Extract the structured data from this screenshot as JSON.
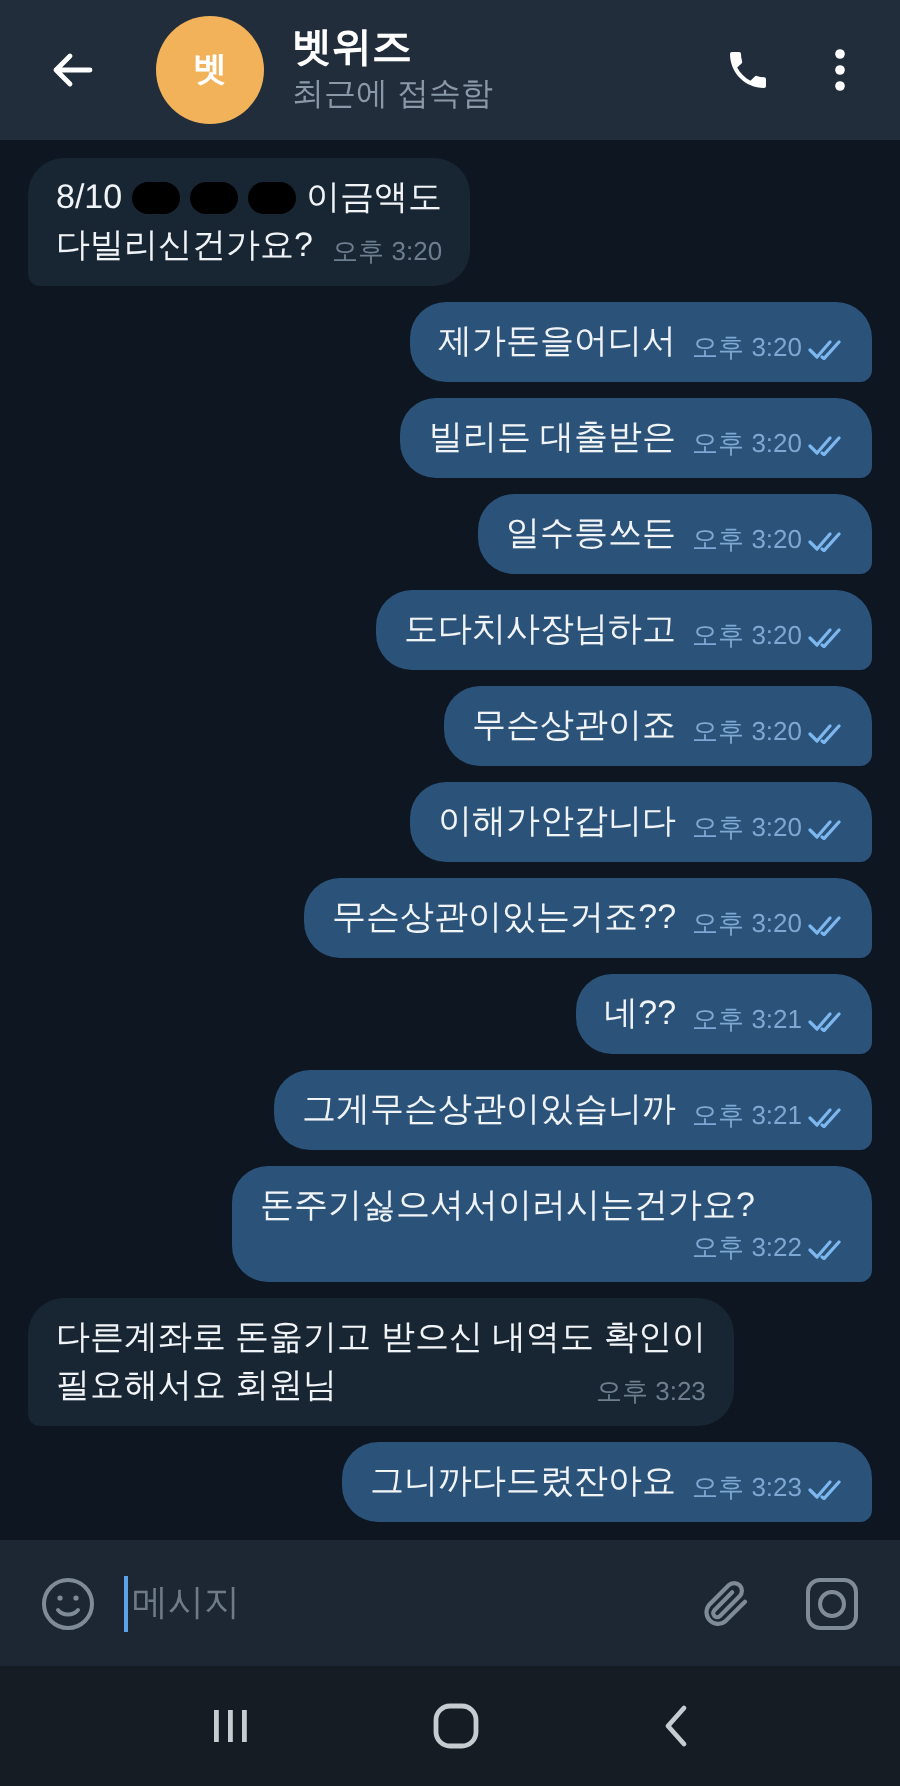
{
  "header": {
    "avatar_letter": "벳",
    "name": "벳위즈",
    "status": "최근에 접속함"
  },
  "messages": [
    {
      "kind": "incoming",
      "lines": [
        [
          {
            "kind": "text",
            "text": "8/10"
          },
          {
            "kind": "redacted"
          },
          {
            "kind": "redacted"
          },
          {
            "kind": "redacted"
          },
          {
            "kind": "text",
            "text": "이금액도"
          }
        ],
        [
          {
            "kind": "text",
            "text": "다빌리신건가요?"
          }
        ]
      ],
      "time": "오후 3:20"
    },
    {
      "kind": "outgoing",
      "lines": [
        [
          {
            "kind": "text",
            "text": "제가돈을어디서"
          }
        ]
      ],
      "time": "오후 3:20",
      "read": true
    },
    {
      "kind": "outgoing",
      "lines": [
        [
          {
            "kind": "text",
            "text": "빌리든 대출받은"
          }
        ]
      ],
      "time": "오후 3:20",
      "read": true
    },
    {
      "kind": "outgoing",
      "lines": [
        [
          {
            "kind": "text",
            "text": "일수릉쓰든"
          }
        ]
      ],
      "time": "오후 3:20",
      "read": true
    },
    {
      "kind": "outgoing",
      "lines": [
        [
          {
            "kind": "text",
            "text": "도다치사장님하고"
          }
        ]
      ],
      "time": "오후 3:20",
      "read": true
    },
    {
      "kind": "outgoing",
      "lines": [
        [
          {
            "kind": "text",
            "text": "무슨상관이죠"
          }
        ]
      ],
      "time": "오후 3:20",
      "read": true
    },
    {
      "kind": "outgoing",
      "lines": [
        [
          {
            "kind": "text",
            "text": "이해가안갑니다"
          }
        ]
      ],
      "time": "오후 3:20",
      "read": true
    },
    {
      "kind": "outgoing",
      "lines": [
        [
          {
            "kind": "text",
            "text": "무슨상관이있는거죠??"
          }
        ]
      ],
      "time": "오후 3:20",
      "read": true
    },
    {
      "kind": "outgoing",
      "lines": [
        [
          {
            "kind": "text",
            "text": "네??"
          }
        ]
      ],
      "time": "오후 3:21",
      "read": true
    },
    {
      "kind": "outgoing",
      "lines": [
        [
          {
            "kind": "text",
            "text": "그게무슨상관이있습니까"
          }
        ]
      ],
      "time": "오후 3:21",
      "read": true
    },
    {
      "kind": "outgoing",
      "lines": [
        [
          {
            "kind": "text",
            "text": "돈주기싫으셔서이러시는건가요?"
          }
        ]
      ],
      "time": "오후 3:22",
      "read": true
    },
    {
      "kind": "incoming",
      "lines": [
        [
          {
            "kind": "text",
            "text": "다른계좌로 돈옮기고 받으신 내역도 확인이"
          }
        ],
        [
          {
            "kind": "text",
            "text": "필요해서요 회원님"
          }
        ]
      ],
      "time": "오후 3:23"
    },
    {
      "kind": "outgoing",
      "lines": [
        [
          {
            "kind": "text",
            "text": "그니까다드렸잔아요"
          }
        ]
      ],
      "time": "오후 3:23",
      "read": true
    }
  ],
  "composer": {
    "placeholder": "메시지"
  }
}
